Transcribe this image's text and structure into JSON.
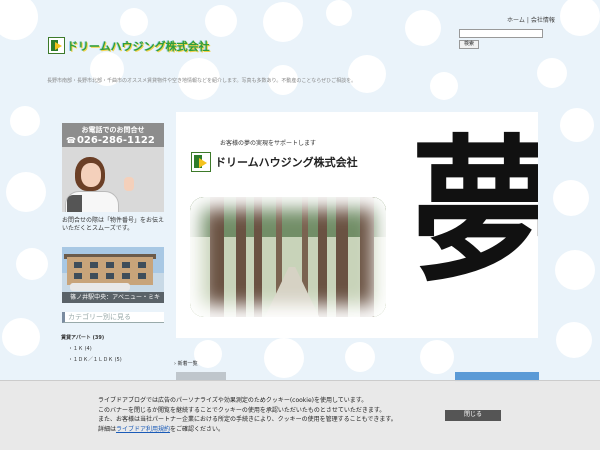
{
  "header": {
    "nav_home": "ホーム",
    "nav_sep": "|",
    "nav_company": "会社情報",
    "search_button": "検索",
    "search_value": "",
    "logo_text": "ドリームハウジング株式会社",
    "tagline": "長野市南部・長野市北部・千曲市のオススメ賃貸物件や空き地情報などを紹介します。写真も多数あり。不動産のことならぜひご相談を。"
  },
  "sidebar": {
    "phone_label": "お電話でのお問合せ",
    "phone_icon": "☎",
    "phone_number": "026-286-1122",
    "note": "お問合せの際は「物件番号」をお伝えいただくとスムーズです。",
    "photo_caption": "篠ノ井駅中央：アベニュー・ミキ",
    "category_heading": "カテゴリー別に見る",
    "categories": {
      "main": "賃貸アパート (39)",
      "sub1": "・１Ｋ (4)",
      "sub2": "・１ＤＫ／１ＬＤＫ (5)"
    }
  },
  "hero": {
    "tagline": "お客様の夢の実現をサポートします",
    "company": "ドリームハウジング株式会社",
    "kanji": "夢"
  },
  "main": {
    "new_heading": "新着一覧"
  },
  "cookie": {
    "line1": "ライブドアブログでは広告のパーソナライズや効果測定のためクッキー(cookie)を使用しています。",
    "line2": "このバナーを閉じるか閲覧を継続することでクッキーの使用を承認いただいたものとさせていただきます。",
    "line3": "また、お客様は当社パートナー企業における所定の手続きにより、クッキーの使用を管理することもできます。",
    "line4_prefix": "詳細は",
    "line4_link": "ライブドア利用規約",
    "line4_suffix": "をご確認ください。",
    "close_button": "閉じる"
  },
  "colors": {
    "background": "#eaf3fa",
    "logo_green": "#2f9e3a",
    "accent_blue": "#5b9ad6",
    "close_button": "#555555"
  }
}
